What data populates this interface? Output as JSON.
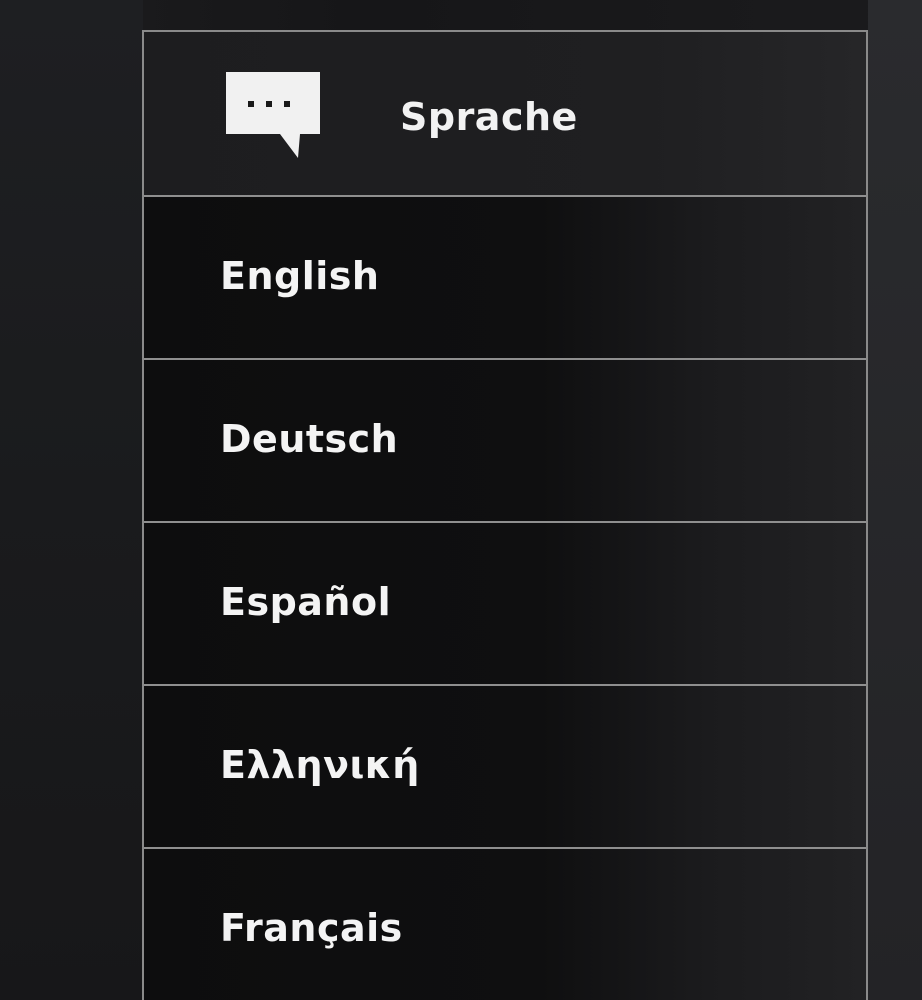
{
  "menu": {
    "header": {
      "icon": "speech-bubble-icon",
      "title": "Sprache"
    },
    "items": [
      {
        "label": "English"
      },
      {
        "label": "Deutsch"
      },
      {
        "label": "Español"
      },
      {
        "label": "Ελληνική"
      },
      {
        "label": "Français"
      }
    ]
  },
  "colors": {
    "background": "#161618",
    "panel": "#0f0f10",
    "border": "#8f8f8f",
    "text": "#f4f4f4"
  }
}
